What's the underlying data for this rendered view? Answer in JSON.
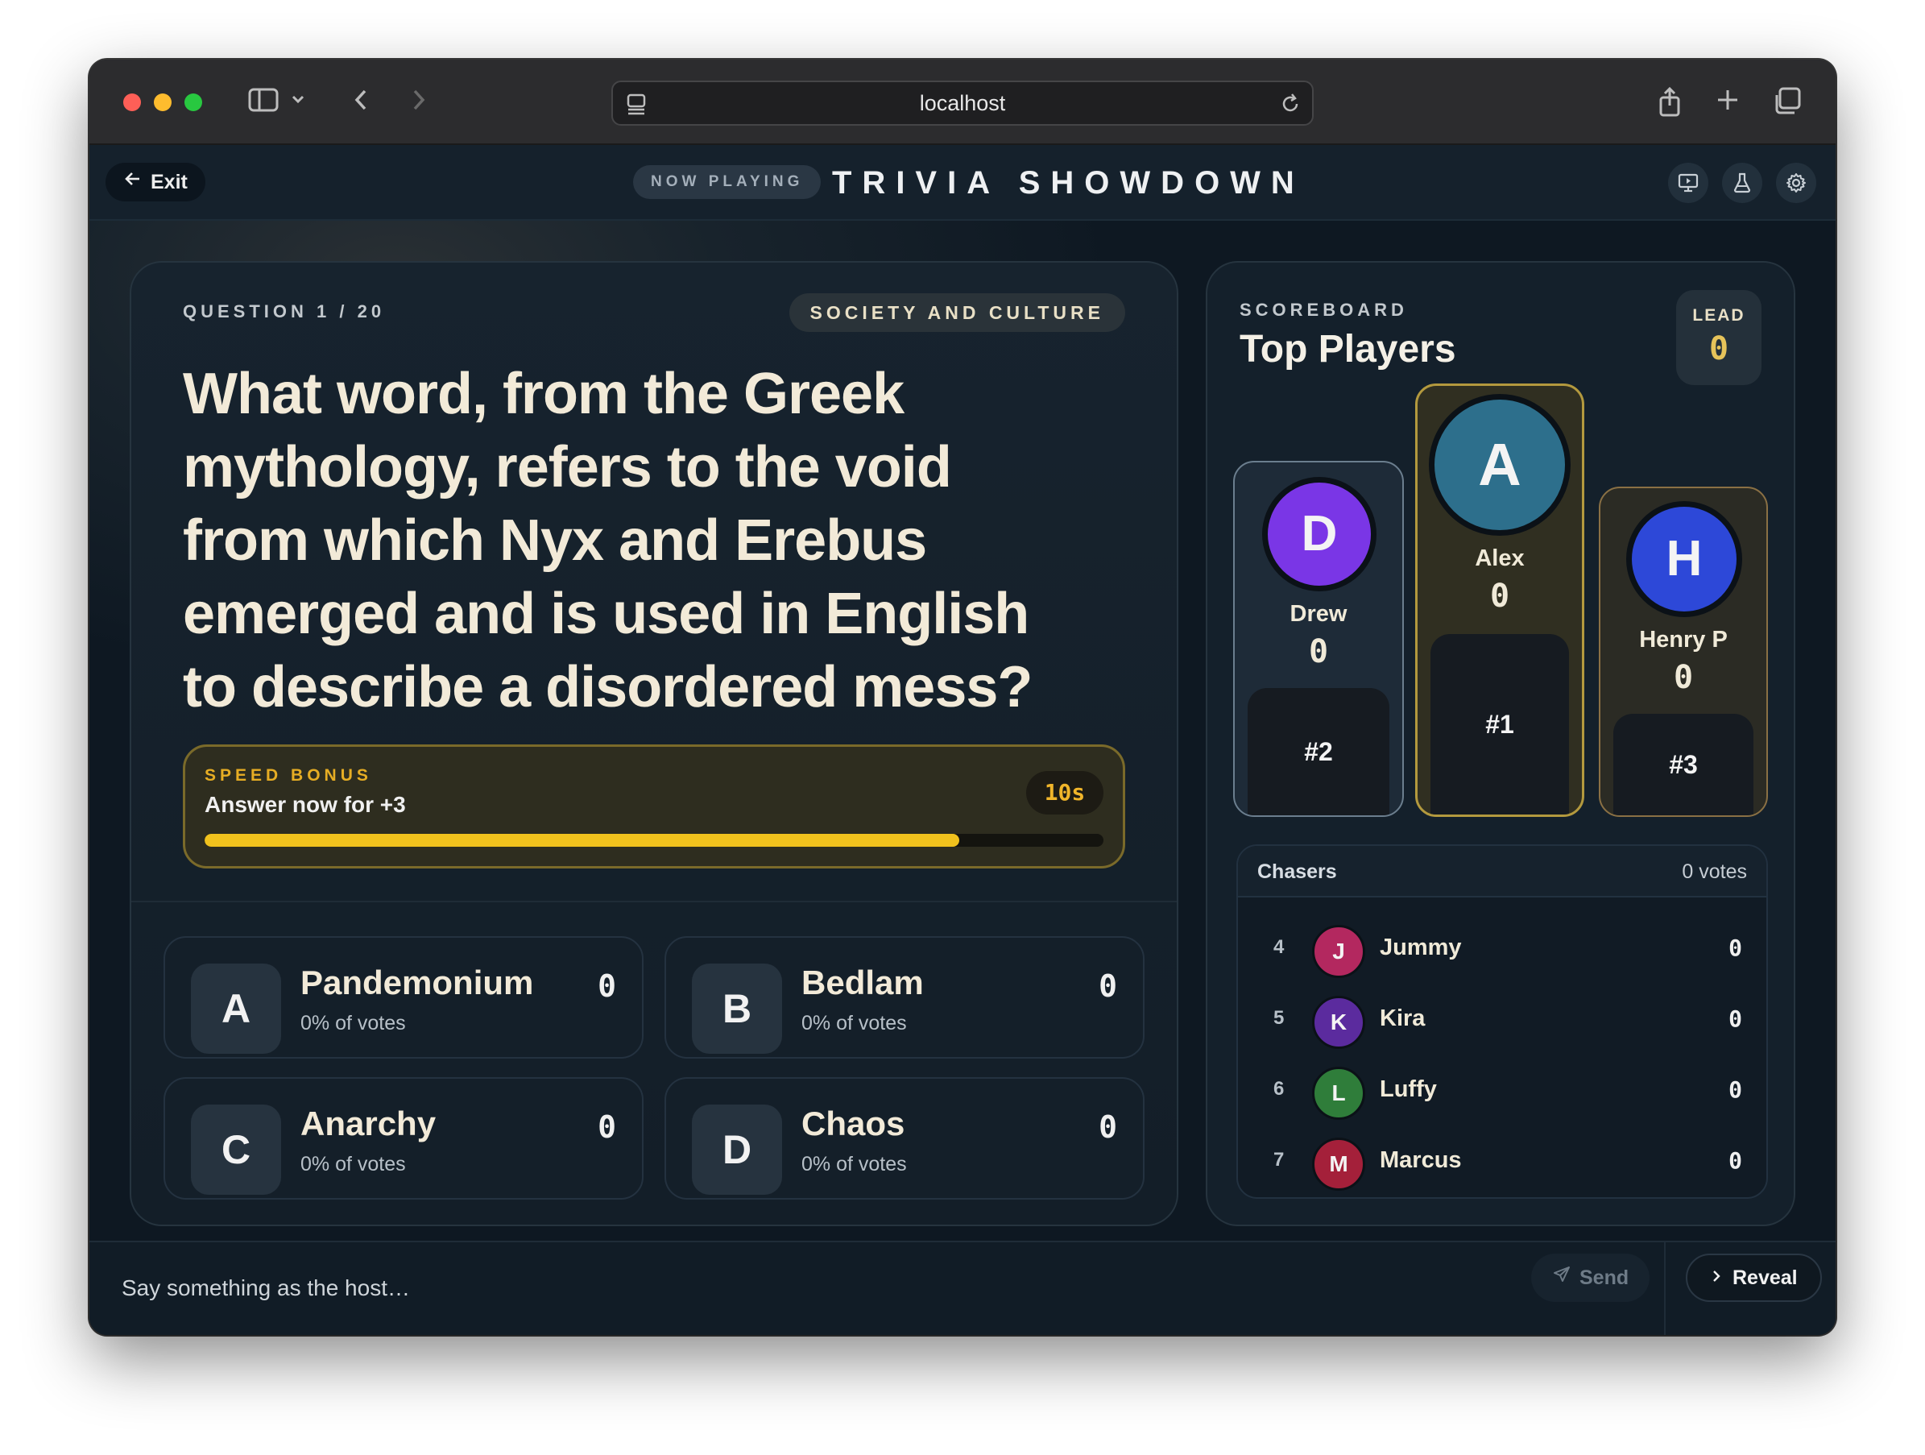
{
  "browser": {
    "url": "localhost"
  },
  "header": {
    "exit_label": "Exit",
    "now_playing": "NOW PLAYING",
    "title": "TRIVIA SHOWDOWN",
    "icons": [
      "screen-share-icon",
      "flask-icon",
      "gear-icon"
    ]
  },
  "question": {
    "label": "QUESTION 1 / 20",
    "category": "SOCIETY AND CULTURE",
    "text": "What word, from the Greek mythology, refers to the void from which Nyx and Erebus emerged and is used in English to describe a disordered mess?"
  },
  "speed_bonus": {
    "label": "SPEED BONUS",
    "text": "Answer now for +3",
    "time": "10s",
    "progress": 0.84
  },
  "answers": [
    {
      "letter": "A",
      "text": "Pandemonium",
      "pct": "0% of votes",
      "count": "0"
    },
    {
      "letter": "B",
      "text": "Bedlam",
      "pct": "0% of votes",
      "count": "0"
    },
    {
      "letter": "C",
      "text": "Anarchy",
      "pct": "0% of votes",
      "count": "0"
    },
    {
      "letter": "D",
      "text": "Chaos",
      "pct": "0% of votes",
      "count": "0"
    }
  ],
  "scoreboard": {
    "label": "SCOREBOARD",
    "title": "Top Players",
    "lead_label": "LEAD",
    "lead_value": "0",
    "podium": [
      {
        "initial": "D",
        "name": "Drew",
        "score": "0",
        "rank": "#2",
        "color": "#7a36e6"
      },
      {
        "initial": "A",
        "name": "Alex",
        "score": "0",
        "rank": "#1",
        "color": "#2d6f8c"
      },
      {
        "initial": "H",
        "name": "Henry P",
        "score": "0",
        "rank": "#3",
        "color": "#2d48d8"
      }
    ],
    "chasers_title": "Chasers",
    "chasers_votes": "0 votes",
    "chasers": [
      {
        "rank": "4",
        "initial": "J",
        "name": "Jummy",
        "score": "0",
        "color": "#b3285f"
      },
      {
        "rank": "5",
        "initial": "K",
        "name": "Kira",
        "score": "0",
        "color": "#5b2b9e"
      },
      {
        "rank": "6",
        "initial": "L",
        "name": "Luffy",
        "score": "0",
        "color": "#2f7d3a"
      },
      {
        "rank": "7",
        "initial": "M",
        "name": "Marcus",
        "score": "0",
        "color": "#a4203a"
      }
    ]
  },
  "footer": {
    "placeholder": "Say something as the host…",
    "send_label": "Send",
    "reveal_label": "Reveal"
  }
}
